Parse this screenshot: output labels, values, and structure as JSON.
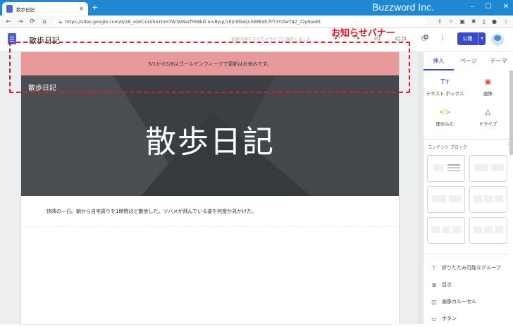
{
  "browser": {
    "tab_title": "散歩日記",
    "url": "https://sites.google.com/d/1B_vGECnLV5oYmH7WTAMacfY68kD-mvRy/p/1KjCMXeljCE6PEdh7FT3YztwT82_72p9/edit",
    "brand": "Buzzword Inc.",
    "nav_icons": [
      "back-icon",
      "forward-icon",
      "reload-icon",
      "home-icon"
    ]
  },
  "sites_toolbar": {
    "site_title": "散歩日記",
    "save_status": "変更内容をすべてドライブに保存しました",
    "publish_label": "公開",
    "icons": [
      "undo-icon",
      "redo-icon",
      "preview-icon",
      "link-icon",
      "share-icon",
      "settings-icon",
      "more-icon"
    ]
  },
  "annotation": {
    "label": "お知らせバナー",
    "color": "#e0182a"
  },
  "page": {
    "banner_text": "5/1から5/8はゴールデンウィークで更新はお休みです。",
    "banner_color": "#e89a9b",
    "nav_title": "散歩日記",
    "hero_heading": "散歩日記",
    "body_text": "快晴の一日。朝から自宅周りを1時間ほど散歩した。ツバメが飛んでいる姿を何度か見かけた。"
  },
  "panel": {
    "tabs": [
      "挿入",
      "ページ",
      "テーマ"
    ],
    "insert_items": [
      {
        "label": "テキスト ボックス",
        "icon": "text-box-icon"
      },
      {
        "label": "画像",
        "icon": "image-icon"
      },
      {
        "label": "埋め込む",
        "icon": "embed-icon"
      },
      {
        "label": "ドライブ",
        "icon": "drive-icon"
      }
    ],
    "content_blocks_label": "コンテンツ ブロック",
    "list_items": [
      {
        "label": "折りたたみ可能なグループ",
        "icon": "collapsible-group-icon"
      },
      {
        "label": "目次",
        "icon": "table-of-contents-icon"
      },
      {
        "label": "画像カルーセル",
        "icon": "image-carousel-icon"
      },
      {
        "label": "ボタン",
        "icon": "button-icon"
      }
    ]
  }
}
